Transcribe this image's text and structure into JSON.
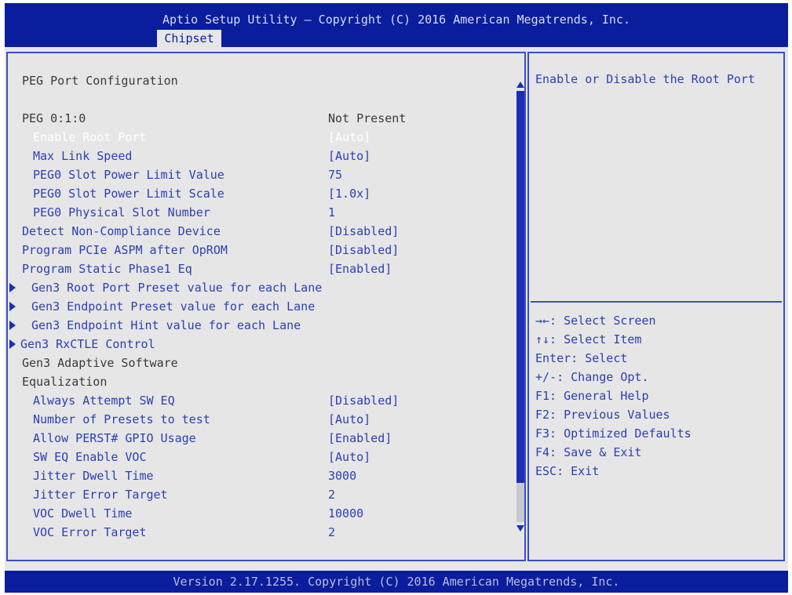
{
  "header": {
    "title": "Aptio Setup Utility – Copyright (C) 2016 American Megatrends, Inc.",
    "tab": "Chipset"
  },
  "section_title": "PEG Port Configuration",
  "rows": [
    {
      "label": "PEG 0:1:0",
      "value": "Not Present",
      "indent": 0,
      "style": "gray"
    },
    {
      "label": "Enable Root Port",
      "value": "[Auto]",
      "indent": 1,
      "style": "white"
    },
    {
      "label": "Max Link Speed",
      "value": "[Auto]",
      "indent": 1,
      "style": "blue"
    },
    {
      "label": "PEG0 Slot Power Limit Value",
      "value": "75",
      "indent": 1,
      "style": "blue"
    },
    {
      "label": "PEG0 Slot Power Limit Scale",
      "value": "[1.0x]",
      "indent": 1,
      "style": "blue"
    },
    {
      "label": "PEG0 Physical Slot Number",
      "value": "1",
      "indent": 1,
      "style": "blue"
    },
    {
      "label": "Detect Non-Compliance Device",
      "value": "[Disabled]",
      "indent": 0,
      "style": "blue"
    },
    {
      "label": "Program PCIe ASPM after OpROM",
      "value": "[Disabled]",
      "indent": 0,
      "style": "blue"
    },
    {
      "label": "Program Static Phase1 Eq",
      "value": "[Enabled]",
      "indent": 0,
      "style": "blue"
    }
  ],
  "submenus": [
    "Gen3 Root Port Preset value for each Lane",
    "Gen3 Endpoint Preset value for each Lane",
    "Gen3 Endpoint Hint value for each Lane",
    "Gen3 RxCTLE Control"
  ],
  "adaptive_heading": [
    "Gen3 Adaptive Software",
    "Equalization"
  ],
  "adaptive_rows": [
    {
      "label": "Always Attempt SW EQ",
      "value": "[Disabled]"
    },
    {
      "label": "Number of Presets to test",
      "value": "[Auto]"
    },
    {
      "label": "Allow PERST# GPIO Usage",
      "value": "[Enabled]"
    },
    {
      "label": "SW EQ Enable VOC",
      "value": "[Auto]"
    },
    {
      "label": "Jitter Dwell Time",
      "value": "3000"
    },
    {
      "label": "Jitter Error Target",
      "value": "2"
    },
    {
      "label": "VOC Dwell Time",
      "value": "10000"
    },
    {
      "label": "VOC Error Target",
      "value": "2"
    }
  ],
  "help": {
    "description": "Enable or Disable the Root Port",
    "keys": [
      "→←: Select Screen",
      "↑↓: Select Item",
      "Enter: Select",
      "+/-: Change Opt.",
      "F1: General Help",
      "F2: Previous Values",
      "F3: Optimized Defaults",
      "F4: Save & Exit",
      "ESC: Exit"
    ]
  },
  "footer": "Version 2.17.1255. Copyright (C) 2016 American Megatrends, Inc.",
  "colors": {
    "header_bg": "#0a1d9c",
    "panel_bg": "#e6e6e6",
    "selected_text": "#ffffff",
    "option_text": "#2a3fb6",
    "static_text": "#3a3a3a"
  }
}
